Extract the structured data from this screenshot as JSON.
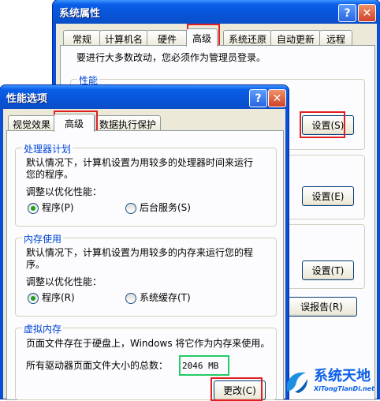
{
  "sysprops": {
    "title": "系统属性",
    "help_glyph": "?",
    "close_glyph": "✕",
    "tabs": [
      "常规",
      "计算机名",
      "硬件",
      "高级",
      "系统还原",
      "自动更新",
      "远程"
    ],
    "admin_notice": "要进行大多数改动，您必须作为管理员登录。",
    "perf_group_title": "性能",
    "settings1": "设置(S)",
    "settings2": "设置(E)",
    "settings3": "设置(T)",
    "error_report": "误报告(R)"
  },
  "perf": {
    "title": "性能选项",
    "help_glyph": "?",
    "close_glyph": "✕",
    "tabs": [
      "视觉效果",
      "高级",
      "数据执行保护"
    ],
    "processor": {
      "title": "处理器计划",
      "desc_line1": "默认情况下，计算机设置为用较多的处理器时间来运行",
      "desc_line2": "您的程序。",
      "optimize_label": "调整以优化性能：",
      "opt_programs": "程序(P)",
      "opt_background": "后台服务(S)"
    },
    "memory": {
      "title": "内存使用",
      "desc_line1": "默认情况下，计算机设置为用较多的内存来运行您的程",
      "desc_line2": "序。",
      "optimize_label": "调整以优化性能：",
      "opt_programs": "程序(R)",
      "opt_cache": "系统缓存(T)"
    },
    "virtual": {
      "title": "虚拟内存",
      "desc": "页面文件存在于硬盘上，Windows 将它作为内存来使用。",
      "total_label": "所有驱动器页面文件大小的总数：",
      "total_value": "2046 MB",
      "change_button": "更改(C)"
    }
  },
  "watermark": {
    "brand": "系统天地",
    "url": "XiTongTianDi.net"
  },
  "colors": {
    "xp_title_blue": "#0a5ee8",
    "highlight_red": "#e02020",
    "highlight_green": "#22cc66"
  }
}
